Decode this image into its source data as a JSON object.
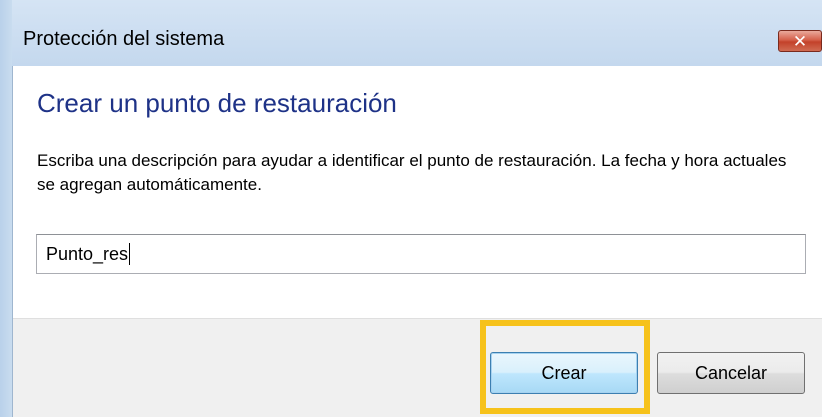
{
  "window": {
    "title": "Protección del sistema",
    "close_label": "✕"
  },
  "dialog": {
    "heading": "Crear un punto de restauración",
    "description": "Escriba una descripción para ayudar a identificar el punto de restauración. La fecha y hora actuales se agregan automáticamente.",
    "input_value": "Punto_res"
  },
  "buttons": {
    "create_label": "Crear",
    "cancel_label": "Cancelar"
  },
  "colors": {
    "heading": "#1e3287",
    "highlight": "#f6c21b",
    "close_button": "#c3412a"
  }
}
